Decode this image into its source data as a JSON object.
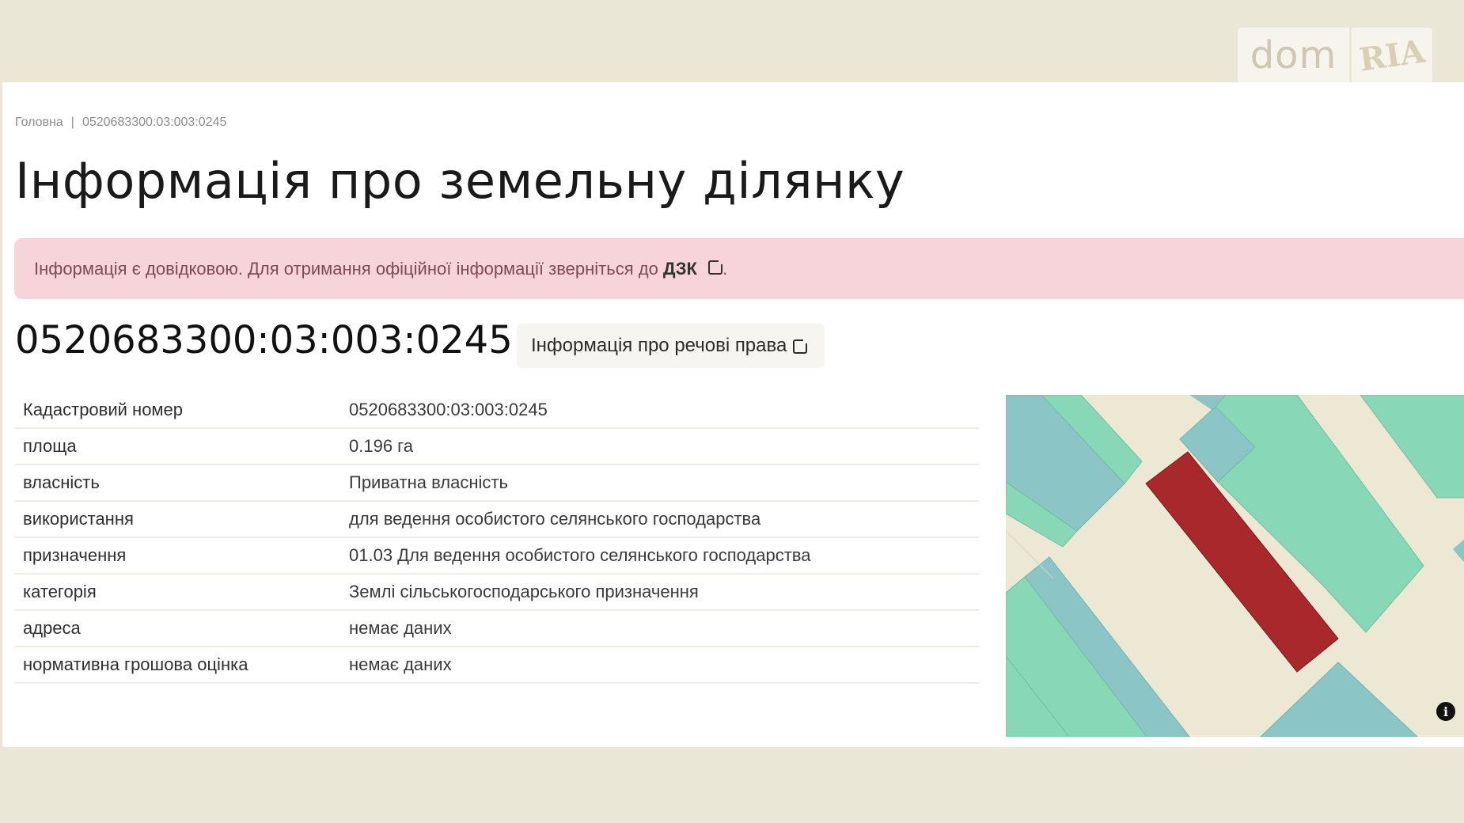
{
  "watermark": {
    "left": "dom",
    "right": "RIA"
  },
  "breadcrumb": {
    "home": "Головна",
    "separator": "|",
    "current": "0520683300:03:003:0245"
  },
  "page_title": "Інформація про земельну ділянку",
  "alert": {
    "text": "Інформація є довідковою. Для отримання офіційної інформації зверніться до",
    "link": "ДЗК",
    "suffix": "."
  },
  "cadastral_title": "0520683300:03:003:0245",
  "rights_button_label": "Інформація про речові права",
  "table": {
    "rows": [
      {
        "key": "Кадастровий номер",
        "value": "0520683300:03:003:0245"
      },
      {
        "key": "площа",
        "value": "0.196 га"
      },
      {
        "key": "власність",
        "value": "Приватна власність"
      },
      {
        "key": "використання",
        "value": "для ведення особистого селянського господарства"
      },
      {
        "key": "призначення",
        "value": "01.03 Для ведення особистого селянського господарства"
      },
      {
        "key": "категорія",
        "value": "Землі сільськогосподарського призначення"
      },
      {
        "key": "адреса",
        "value": "немає даних"
      },
      {
        "key": "нормативна грошова оцінка",
        "value": "немає даних"
      }
    ]
  },
  "map": {
    "info_glyph": "i",
    "colors": {
      "background": "#ece8d4",
      "green": "#88d8b8",
      "teal": "#8cc5c6",
      "selected": "#a8282b"
    }
  }
}
